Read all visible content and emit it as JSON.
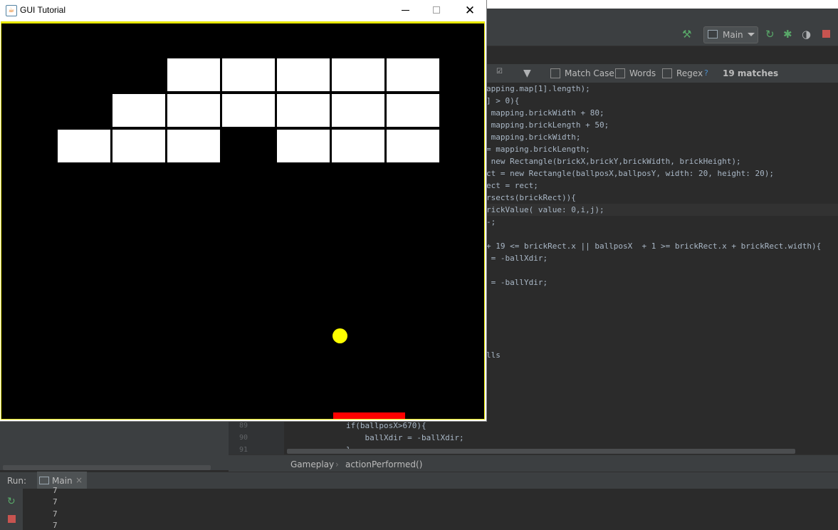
{
  "window": {
    "title": "GUI Tutorial",
    "close_glyph": "✕"
  },
  "game": {
    "brick_rows": [
      [
        0,
        0,
        1,
        1,
        1,
        1,
        1
      ],
      [
        0,
        1,
        1,
        1,
        1,
        1,
        1
      ],
      [
        1,
        1,
        1,
        0,
        1,
        1,
        1
      ]
    ],
    "colors": {
      "background": "#000000",
      "border": "#e8e800",
      "brick": "#ffffff",
      "ball": "#ffff00",
      "paddle": "#ff0000"
    }
  },
  "toolbar": {
    "run_config": "Main"
  },
  "find_bar": {
    "match_case": "Match Case",
    "words": "Words",
    "regex": "Regex",
    "help": "?",
    "matches": "19 matches"
  },
  "code": {
    "lines": [
      "apping.map[1].length);",
      "] > 0){",
      " mapping.brickWidth + 80;",
      " mapping.brickLength + 50;",
      " mapping.brickWidth;",
      "= mapping.brickLength;",
      " new Rectangle(brickX,brickY,brickWidth, brickHeight);",
      "ct = new Rectangle(ballposX,ballposY, width: 20, height: 20);",
      "ect = rect;",
      "rsects(brickRect)){",
      "rickValue( value: 0,i,j);",
      "-;",
      "",
      "+ 19 <= brickRect.x || ballposX  + 1 >= brickRect.x + brickRect.width){",
      " = -ballXdir;",
      "",
      " = -ballYdir;",
      "",
      "",
      "",
      "",
      "",
      "lls"
    ],
    "bottom_lines": [
      {
        "num": "89",
        "text": "if(ballposX>670){"
      },
      {
        "num": "90",
        "text": "    ballXdir = -ballXdir;"
      },
      {
        "num": "91",
        "text": "}"
      }
    ]
  },
  "breadcrumb": {
    "class_name": "Gameplay",
    "separator": "›",
    "method_name": "actionPerformed()"
  },
  "run_panel": {
    "label": "Run:",
    "tab_label": "Main",
    "tab_close": "×",
    "output": [
      "7",
      "7",
      "7",
      "7"
    ]
  },
  "icons": {
    "hammer": "hammer-icon",
    "rerun": "rerun-icon",
    "debug": "debug-icon",
    "coverage": "coverage-icon",
    "stop": "stop-icon",
    "filter": "filter-icon"
  }
}
